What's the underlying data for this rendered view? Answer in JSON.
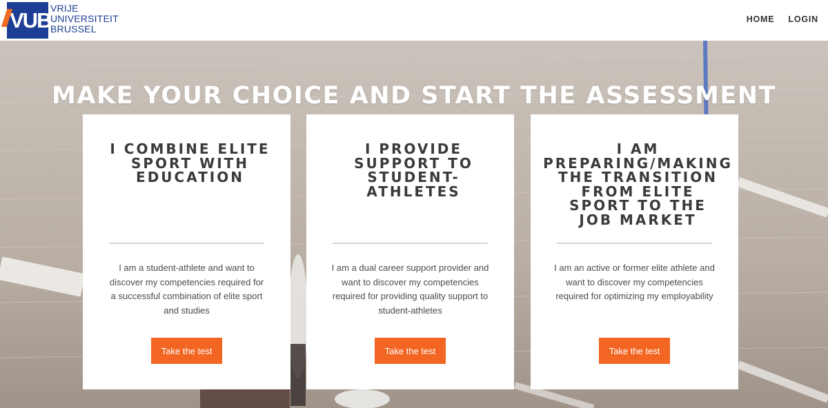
{
  "header": {
    "logo": {
      "mark": "VUB",
      "line1": "VRIJE",
      "line2": "UNIVERSITEIT",
      "line3": "BRUSSEL"
    },
    "nav": {
      "home": "HOME",
      "login": "LOGIN"
    }
  },
  "hero": {
    "title": "MAKE YOUR CHOICE AND START THE ASSESSMENT"
  },
  "cards": [
    {
      "title": "I COMBINE ELITE\nSPORT WITH\nEDUCATION",
      "description": "I am a student-athlete and want to discover my competencies required for a successful combination of elite sport and studies",
      "button": "Take the test"
    },
    {
      "title": "I PROVIDE\nSUPPORT TO\nSTUDENT-\nATHLETES",
      "description": "I am a dual career support provider and want to discover my competencies required for providing quality support to student-athletes",
      "button": "Take the test"
    },
    {
      "title": "I AM\nPREPARING/MAKING\nTHE TRANSITION\nFROM ELITE\nSPORT TO THE\nJOB MARKET",
      "description": "I am an active or former elite athlete and want to discover my competencies required for optimizing my employability",
      "button": "Take the test"
    }
  ],
  "colors": {
    "brand_blue": "#1c3e93",
    "brand_orange": "#f26522",
    "header_bg": "#ffffff",
    "card_bg": "#ffffff"
  }
}
